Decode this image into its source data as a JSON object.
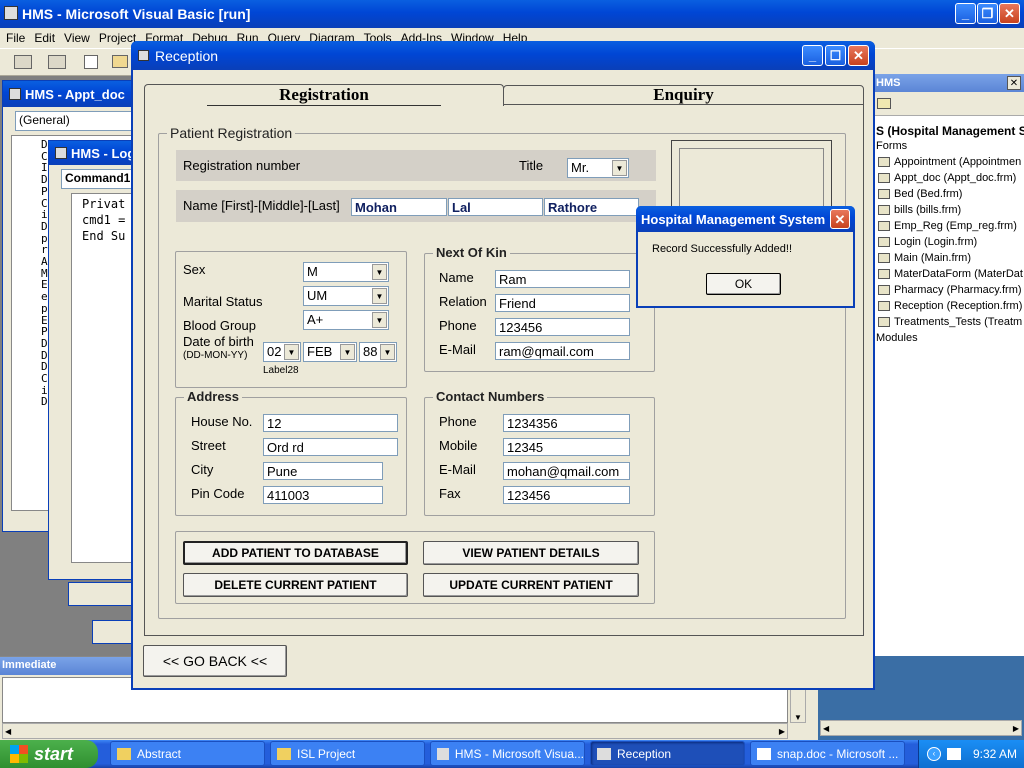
{
  "vb": {
    "title": "HMS - Microsoft Visual Basic [run]",
    "menu": [
      "File",
      "Edit",
      "View",
      "Project",
      "Format",
      "Debug",
      "Run",
      "Query",
      "Diagram",
      "Tools",
      "Add-Ins",
      "Window",
      "Help"
    ],
    "appt_window_title": "HMS - Appt_doc",
    "appt_combo": "(General)",
    "log_window_title": "HMS - Log",
    "log_combo": "Command1",
    "code_lines": [
      "Privat",
      "cmd1 =",
      "End Su"
    ],
    "left_margin_letters": [
      "D",
      "C",
      "I",
      "D",
      "P",
      "C",
      "i",
      "D",
      "p",
      "r",
      "A",
      "M",
      "E",
      "e",
      "p",
      "E",
      "P",
      "D",
      "D",
      "D",
      "C",
      "i",
      "D"
    ],
    "immediate_title": "Immediate"
  },
  "project": {
    "title": "HMS",
    "root": "S (Hospital Management S",
    "forms_label": "Forms",
    "forms": [
      "Appointment (Appointmen",
      "Appt_doc (Appt_doc.frm)",
      "Bed (Bed.frm)",
      "bills (bills.frm)",
      "Emp_Reg (Emp_reg.frm)",
      "Login (Login.frm)",
      "Main (Main.frm)",
      "MaterDataForm (MaterDat",
      "Pharmacy (Pharmacy.frm)",
      "Reception (Reception.frm)",
      "Treatments_Tests (Treatm"
    ],
    "modules_label": "Modules"
  },
  "reception": {
    "title": "Reception",
    "tabs": [
      "Registration",
      "Enquiry"
    ],
    "frame_title": "Patient Registration",
    "reg_number_label": "Registration number",
    "title_label": "Title",
    "title_value": "Mr.",
    "name_label": "Name [First]-[Middle]-[Last]",
    "first_name": "Mohan",
    "middle_name": "Lal",
    "last_name": "Rathore",
    "sex_label": "Sex",
    "sex_value": "M",
    "marital_label": "Marital Status",
    "marital_value": "UM",
    "blood_label": "Blood Group",
    "blood_value": "A+",
    "dob_label": "Date of birth",
    "dob_format": "(DD-MON-YY)",
    "dob_day": "02",
    "dob_month": "FEB",
    "dob_year": "88",
    "label28": "Label28",
    "kin": {
      "title": "Next Of Kin",
      "name_label": "Name",
      "name": "Ram",
      "relation_label": "Relation",
      "relation": "Friend",
      "phone_label": "Phone",
      "phone": "123456",
      "email_label": "E-Mail",
      "email": "ram@qmail.com"
    },
    "address": {
      "title": "Address",
      "house_label": "House No.",
      "house": "12",
      "street_label": "Street",
      "street": "Ord rd",
      "city_label": "City",
      "city": "Pune",
      "pin_label": "Pin Code",
      "pin": "411003"
    },
    "contact": {
      "title": "Contact Numbers",
      "phone_label": "Phone",
      "phone": "1234356",
      "mobile_label": "Mobile",
      "mobile": "12345",
      "email_label": "E-Mail",
      "email": "mohan@qmail.com",
      "fax_label": "Fax",
      "fax": "123456"
    },
    "buttons": {
      "add": "ADD PATIENT TO DATABASE",
      "view": "VIEW PATIENT DETAILS",
      "delete": "DELETE CURRENT PATIENT",
      "update": "UPDATE CURRENT PATIENT",
      "back": "<< GO BACK <<"
    }
  },
  "dialog": {
    "title": "Hospital Management System",
    "message": "Record Successfully Added!!",
    "ok": "OK"
  },
  "taskbar": {
    "start": "start",
    "items": [
      "Abstract",
      "ISL Project",
      "HMS - Microsoft Visua...",
      "Reception",
      "snap.doc - Microsoft ..."
    ],
    "clock": "9:32 AM"
  }
}
